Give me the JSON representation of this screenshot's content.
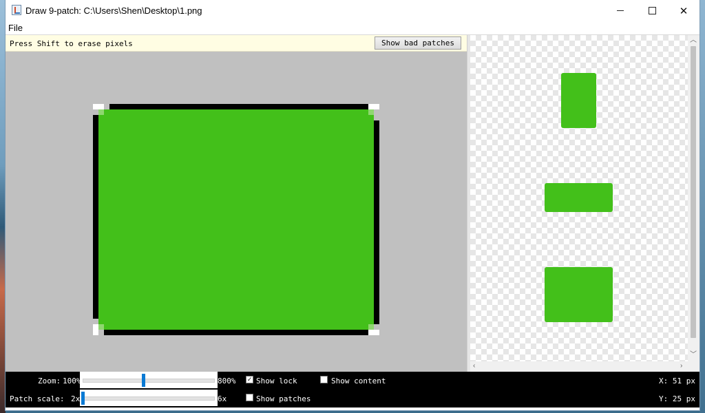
{
  "window": {
    "title": "Draw 9-patch: C:\\Users\\Shen\\Desktop\\1.png",
    "min_glyph": "",
    "close_glyph": "✕"
  },
  "menu": {
    "file": "File"
  },
  "editor": {
    "hint": "Press Shift to erase pixels",
    "bad_patches_button": "Show bad patches"
  },
  "controls": {
    "zoom_label": "Zoom:",
    "zoom_min": "100%",
    "zoom_max": "800%",
    "zoom_value_fraction": 0.46,
    "patch_scale_label": "Patch scale:",
    "patch_min": "2x",
    "patch_max": "6x",
    "patch_value_fraction": 0.0,
    "show_lock_label": "Show lock",
    "show_lock_checked": true,
    "show_content_label": "Show content",
    "show_content_checked": false,
    "show_patches_label": "Show patches",
    "show_patches_checked": false
  },
  "coords": {
    "x": "X: 51 px",
    "y": "Y: 25 px"
  },
  "colors": {
    "patch_green": "#43c01a",
    "slider_thumb": "#0a7ad4"
  },
  "icons": [
    "app-icon",
    "minimize-icon",
    "maximize-icon",
    "close-icon",
    "check-icon",
    "scroll-arrow-up-icon",
    "scroll-arrow-down-icon",
    "scroll-arrow-left-icon",
    "scroll-arrow-right-icon"
  ]
}
